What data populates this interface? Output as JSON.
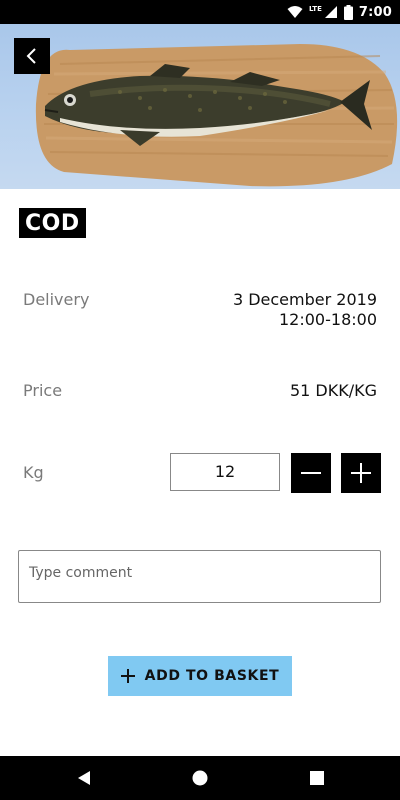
{
  "status_bar": {
    "time": "7:00",
    "network_label": "LTE",
    "icons": [
      "wifi-icon",
      "signal-icon",
      "battery-icon"
    ]
  },
  "hero": {
    "image_subject": "cod fish on wooden board",
    "back_icon": "chevron-left-icon"
  },
  "product": {
    "title": "COD"
  },
  "delivery": {
    "label": "Delivery",
    "date": "3 December 2019",
    "time_window": "12:00-18:00"
  },
  "price": {
    "label": "Price",
    "value": "51 DKK/KG"
  },
  "quantity": {
    "label": "Kg",
    "value": "12",
    "decrease_icon": "minus-icon",
    "increase_icon": "plus-icon"
  },
  "comment": {
    "placeholder": "Type comment"
  },
  "basket": {
    "button_label": "ADD TO BASKET",
    "icon": "plus-icon",
    "color": "#80c9f2"
  },
  "nav_bar": {
    "buttons": [
      "back-triangle-icon",
      "home-circle-icon",
      "recents-square-icon"
    ]
  }
}
